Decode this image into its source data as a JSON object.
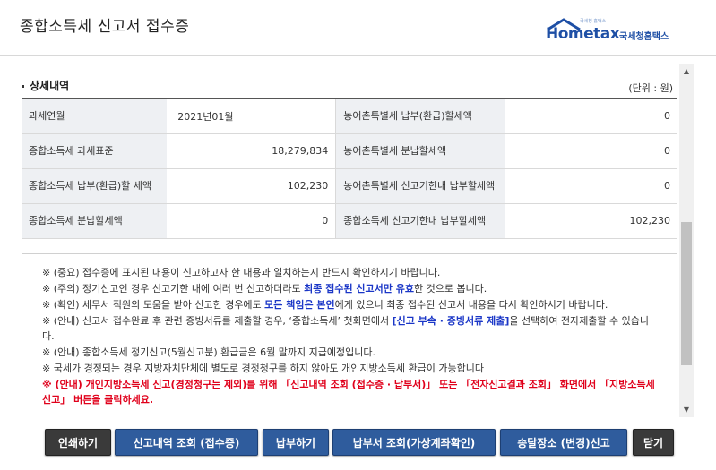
{
  "header": {
    "title": "종합소득세 신고서 접수증",
    "logo_text": "Hometax",
    "logo_subtext": "국세청홈택스",
    "logo_small": "국세청 홈택스"
  },
  "section": {
    "title": "상세내역",
    "unit": "(단위 : 원)"
  },
  "table": {
    "rows": [
      {
        "l1": "과세연월",
        "v1": "2021년01월",
        "l2": "농어촌특별세 납부(환급)할세액",
        "v2": "0"
      },
      {
        "l1": "종합소득세 과세표준",
        "v1": "18,279,834",
        "l2": "농어촌특별세 분납할세액",
        "v2": "0"
      },
      {
        "l1": "종합소득세 납부(환급)할 세액",
        "v1": "102,230",
        "l2": "농어촌특별세 신고기한내 납부할세액",
        "v2": "0"
      },
      {
        "l1": "종합소득세 분납할세액",
        "v1": "0",
        "l2": "종합소득세 신고기한내 납부할세액",
        "v2": "102,230"
      }
    ]
  },
  "notice": {
    "n1": "※ (중요) 접수증에 표시된 내용이 신고하고자 한 내용과 일치하는지 반드시 확인하시기 바랍니다.",
    "n2_a": "※ (주의) 정기신고인 경우 신고기한 내에 여러 번 신고하더라도 ",
    "n2_b": "최종 접수된 신고서만 유효",
    "n2_c": "한 것으로 봅니다.",
    "n3_a": "※ (확인) 세무서 직원의 도움을 받아 신고한 경우에도 ",
    "n3_b": "모든 책임은 본인",
    "n3_c": "에게 있으니 최종 접수된 신고서 내용을 다시 확인하시기 바랍니다.",
    "n4_a": "※ (안내) 신고서 접수완료 후 관련 증빙서류를 제출할 경우, ‘종합소득세’ 첫화면에서 ",
    "n4_b": "[신고 부속 · 증빙서류 제출]",
    "n4_c": "을 선택하여 전자제출할 수 있습니다.",
    "n5": "※ (안내) 종합소득세 정기신고(5월신고분) 환급금은 6월 말까지 지급예정입니다.",
    "n6": "※ 국세가 경정되는 경우 지방자치단체에 별도로 경정청구를 하지 않아도 개인지방소득세 환급이 가능합니다",
    "n7": "※ (안내) 개인지방소득세 신고(경정청구는 제외)를 위해 「신고내역 조회 (접수증 · 납부서)」 또는 「전자신고결과 조회」 화면에서 「지방소득세 신고」 버튼을 클릭하세요."
  },
  "buttons": {
    "print": "인쇄하기",
    "history": "신고내역 조회 (접수증)",
    "pay": "납부하기",
    "payslip": "납부서 조회(가상계좌확인)",
    "address": "송달장소 (변경)신고",
    "close": "닫기"
  }
}
